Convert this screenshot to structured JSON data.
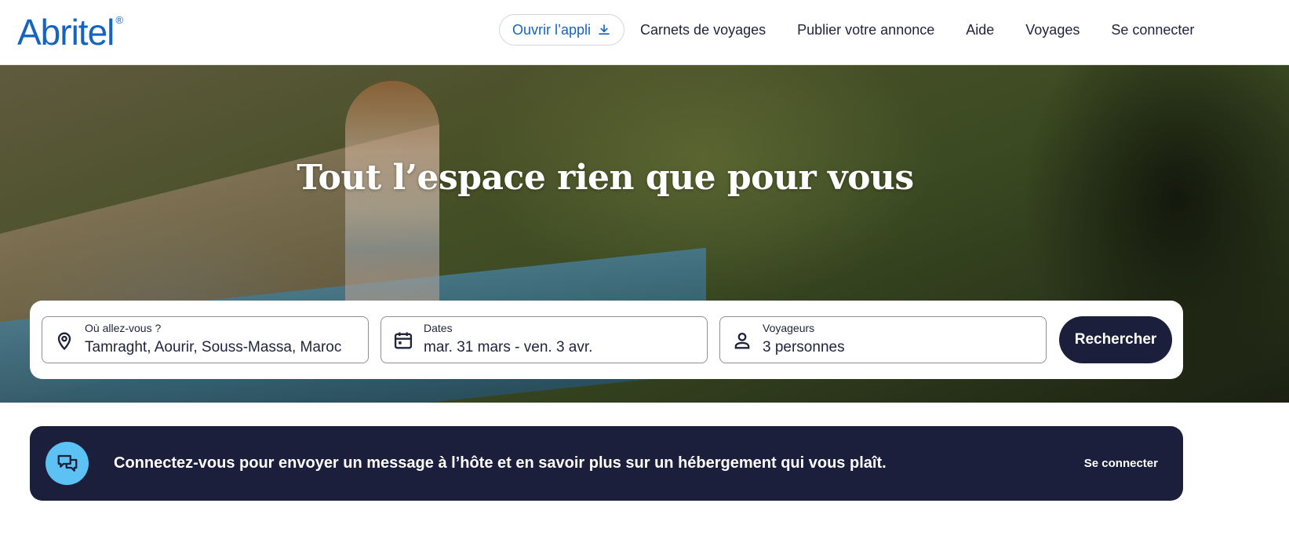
{
  "header": {
    "logo_text": "Abritel",
    "logo_mark": "®",
    "open_app_label": "Ouvrir l’appli",
    "nav_links": [
      "Carnets de voyages",
      "Publier votre annonce",
      "Aide",
      "Voyages",
      "Se connecter"
    ]
  },
  "hero": {
    "title": "Tout l’espace rien que pour vous"
  },
  "search": {
    "destination": {
      "label": "Où allez-vous ?",
      "value": "Tamraght, Aourir, Souss-Massa, Maroc",
      "icon": "location-pin-icon"
    },
    "dates": {
      "label": "Dates",
      "value": "mar. 31 mars - ven. 3 avr.",
      "icon": "calendar-icon"
    },
    "travelers": {
      "label": "Voyageurs",
      "value": "3 personnes",
      "icon": "person-icon"
    },
    "button_label": "Rechercher"
  },
  "banner": {
    "text": "Connectez-vous pour envoyer un message à l’hôte et en savoir plus sur un hébergement qui vous plaît.",
    "link_label": "Se connecter",
    "icon": "chat-bubbles-icon"
  },
  "colors": {
    "brand_blue": "#1565c0",
    "navy": "#1b1f3b",
    "banner_icon_bg": "#5bc2f3"
  }
}
